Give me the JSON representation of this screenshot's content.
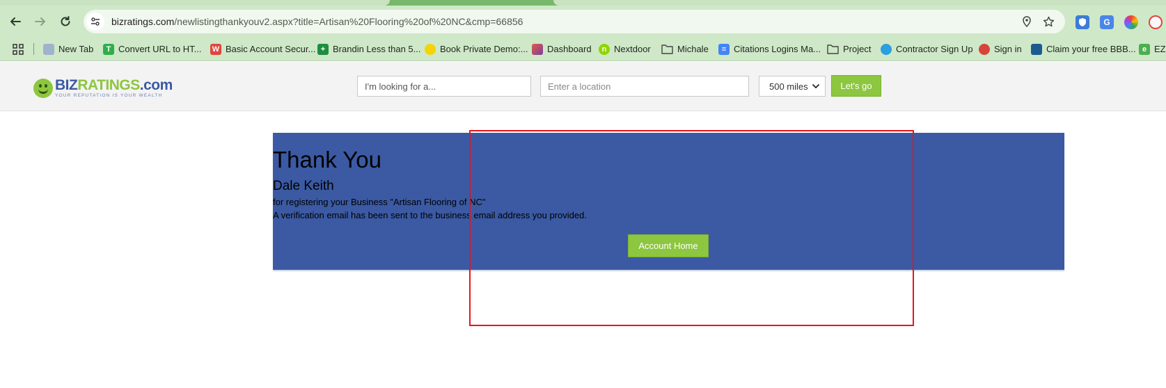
{
  "browser": {
    "url_host": "bizratings.com",
    "url_path": "/newlistingthankyouv2.aspx?title=Artisan%20Flooring%20of%20NC&cmp=66856",
    "bookmarks": [
      {
        "label": "New Tab",
        "icon": "grid-favicon",
        "color": "#6b7f9b"
      },
      {
        "label": "Convert URL to HT...",
        "icon": "t-favicon",
        "color": "#2eaf4a"
      },
      {
        "label": "Basic Account Secur...",
        "icon": "w-favicon",
        "color": "#e0463e"
      },
      {
        "label": "Brandin Less than 5...",
        "icon": "sheets-favicon",
        "color": "#1e8e3e"
      },
      {
        "label": "Book Private Demo:...",
        "icon": "lightbulb-favicon",
        "color": "#f5d30a"
      },
      {
        "label": "Dashboard",
        "icon": "dashboard-favicon",
        "color": "#e25b45"
      },
      {
        "label": "Nextdoor",
        "icon": "nextdoor-favicon",
        "color": "#8ed500"
      },
      {
        "label": "Michale",
        "icon": "folder-icon",
        "color": "#444444"
      },
      {
        "label": "Citations Logins Ma...",
        "icon": "docs-favicon",
        "color": "#4285f4"
      },
      {
        "label": "Project",
        "icon": "folder-icon",
        "color": "#444444"
      },
      {
        "label": "Contractor Sign Up",
        "icon": "wave-favicon",
        "color": "#2b9fe0"
      },
      {
        "label": "Sign in",
        "icon": "bug-favicon",
        "color": "#d6453a"
      },
      {
        "label": "Claim your free BBB...",
        "icon": "bbb-favicon",
        "color": "#1d5b8f"
      },
      {
        "label": "EZlo",
        "icon": "ez-favicon",
        "color": "#4caf50"
      }
    ]
  },
  "header": {
    "logo_biz": "BIZ",
    "logo_ratings": "RATINGS",
    "logo_com": ".com",
    "logo_tagline": "YOUR REPUTATION IS YOUR WEALTH",
    "search_placeholder": "I'm looking for a...",
    "location_placeholder": "Enter a location",
    "distance_value": "500 miles",
    "go_label": "Let's go"
  },
  "thank_you": {
    "title": "Thank You",
    "name": "Dale Keith",
    "line1": "for registering your Business \"Artisan Flooring of NC\"",
    "line2": "A verification email has been sent to the business email address you provided.",
    "button_label": "Account Home"
  },
  "colors": {
    "panel_blue": "#3b5aa3",
    "accent_green": "#8dc63f",
    "highlight_red": "#e8141b"
  }
}
